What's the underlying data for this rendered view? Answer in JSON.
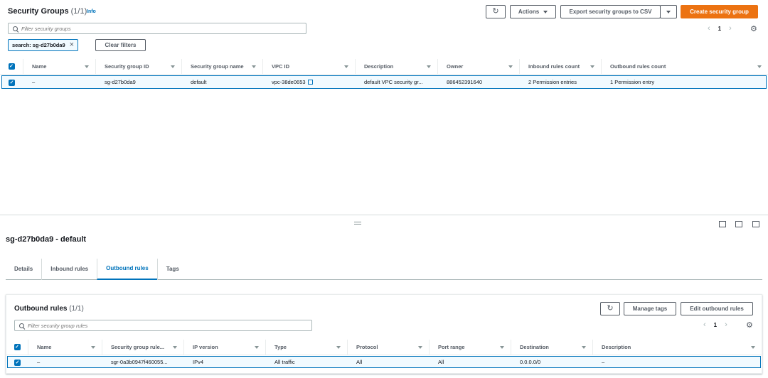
{
  "header": {
    "title": "Security Groups",
    "count": "(1/1)",
    "info": "Info",
    "actions_label": "Actions",
    "export_label": "Export security groups to CSV",
    "create_label": "Create security group"
  },
  "search": {
    "placeholder": "Filter security groups"
  },
  "filter_token": {
    "label": "search: sg-d27b0da9"
  },
  "clear_filters_label": "Clear filters",
  "pagination": {
    "page": "1"
  },
  "sg_table": {
    "columns": [
      "Name",
      "Security group ID",
      "Security group name",
      "VPC ID",
      "Description",
      "Owner",
      "Inbound rules count",
      "Outbound rules count"
    ],
    "rows": [
      {
        "name": "–",
        "sg_id": "sg-d27b0da9",
        "sg_name": "default",
        "vpc_id": "vpc-38de0653",
        "description": "default VPC security gr...",
        "owner": "886452391640",
        "inbound": "2 Permission entries",
        "outbound": "1 Permission entry"
      }
    ]
  },
  "detail": {
    "title": "sg-d27b0da9 - default",
    "tabs": [
      "Details",
      "Inbound rules",
      "Outbound rules",
      "Tags"
    ]
  },
  "outbound": {
    "title": "Outbound rules",
    "count": "(1/1)",
    "manage_tags_label": "Manage tags",
    "edit_label": "Edit outbound rules",
    "search_placeholder": "Filter security group rules",
    "page": "1",
    "columns": [
      "Name",
      "Security group rule...",
      "IP version",
      "Type",
      "Protocol",
      "Port range",
      "Destination",
      "Description"
    ],
    "rows": [
      {
        "name": "–",
        "rule_id": "sgr-0a3b0947f460055...",
        "ip_version": "IPv4",
        "type": "All traffic",
        "protocol": "All",
        "port_range": "All",
        "destination": "0.0.0.0/0",
        "description": "–"
      }
    ]
  },
  "colors": {
    "accent": "#0073bb",
    "primary_button": "#ec7211",
    "selected_row": "#f1faff"
  }
}
